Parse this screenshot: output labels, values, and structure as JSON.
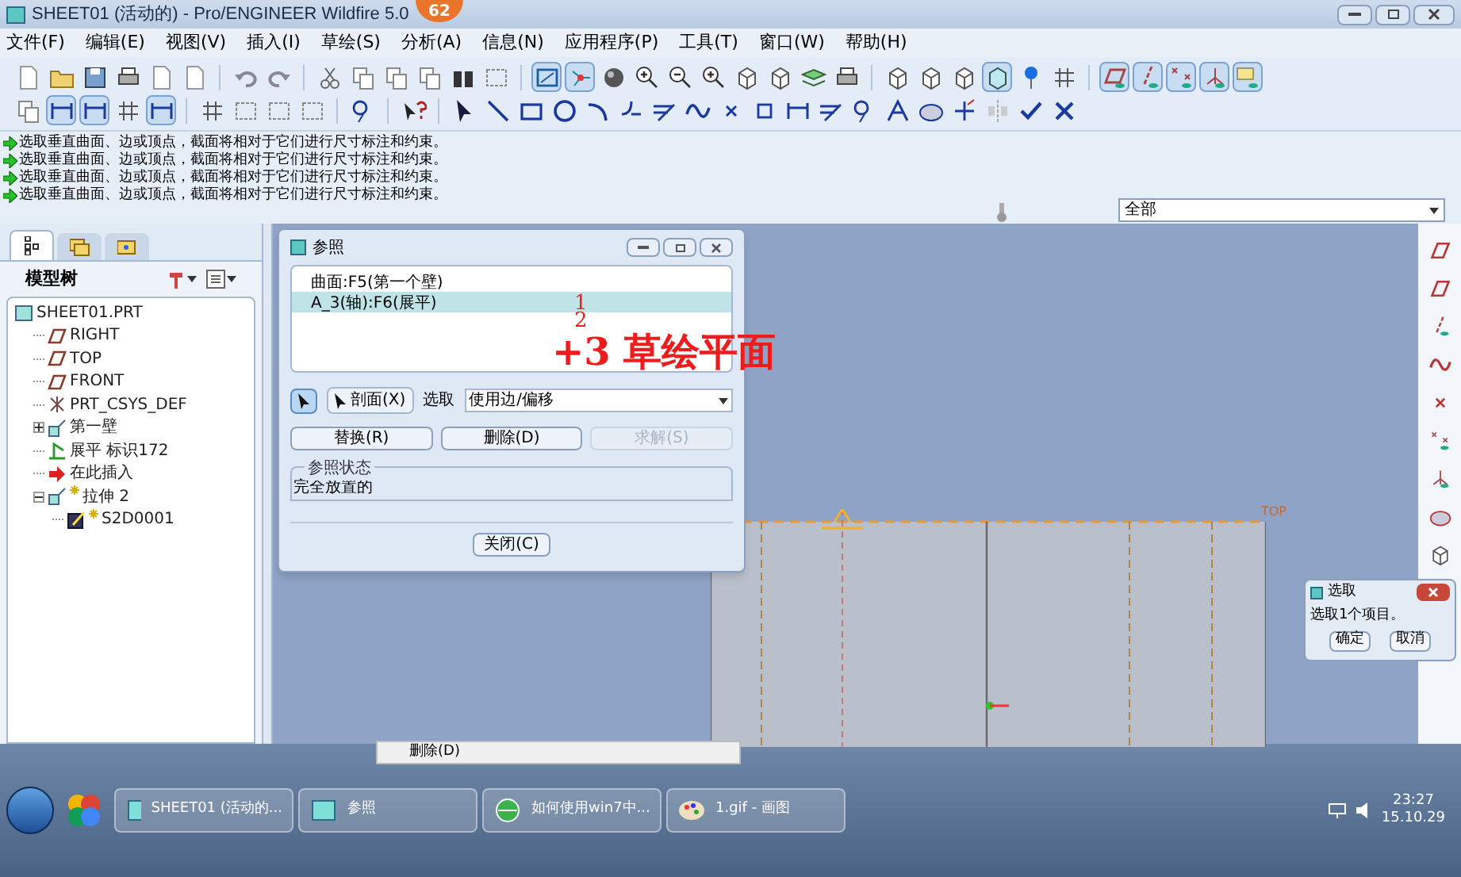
{
  "window": {
    "title": "SHEET01 (活动的) - Pro/ENGINEER Wildfire 5.0",
    "badge": "62"
  },
  "menu": [
    "文件(F)",
    "编辑(E)",
    "视图(V)",
    "插入(I)",
    "草绘(S)",
    "分析(A)",
    "信息(N)",
    "应用程序(P)",
    "工具(T)",
    "窗口(W)",
    "帮助(H)"
  ],
  "messages": [
    "选取垂直曲面、边或顶点，截面将相对于它们进行尺寸标注和约束。",
    "选取垂直曲面、边或顶点，截面将相对于它们进行尺寸标注和约束。",
    "选取垂直曲面、边或顶点，截面将相对于它们进行尺寸标注和约束。",
    "选取垂直曲面、边或顶点，截面将相对于它们进行尺寸标注和约束。"
  ],
  "filter": {
    "value": "全部"
  },
  "model_tree": {
    "title": "模型树",
    "items": [
      {
        "label": "SHEET01.PRT",
        "kind": "part",
        "children": [
          {
            "label": "RIGHT",
            "kind": "plane"
          },
          {
            "label": "TOP",
            "kind": "plane"
          },
          {
            "label": "FRONT",
            "kind": "plane"
          },
          {
            "label": "PRT_CSYS_DEF",
            "kind": "csys"
          },
          {
            "label": "第一壁",
            "kind": "wall",
            "expanded": false
          },
          {
            "label": "展平 标识172",
            "kind": "unbend"
          },
          {
            "label": "在此插入",
            "kind": "insert"
          },
          {
            "label": "拉伸 2",
            "kind": "wall",
            "new": true,
            "expanded": true,
            "children": [
              {
                "label": "S2D0001",
                "kind": "sketch",
                "new": true
              }
            ]
          }
        ]
      }
    ]
  },
  "references_dialog": {
    "title": "参照",
    "references": [
      {
        "label": "曲面:F5(第一个壁)",
        "selected": false
      },
      {
        "label": "A_3(轴):F6(展平)",
        "selected": true
      }
    ],
    "section_button": "剖面(X)",
    "select_label": "选取",
    "select_value": "使用边/偏移",
    "buttons": [
      {
        "label": "替换(R)",
        "disabled": false
      },
      {
        "label": "删除(D)",
        "disabled": false
      },
      {
        "label": "求解(S)",
        "disabled": true
      }
    ],
    "status_title": "参照状态",
    "status": "完全放置的",
    "close_button": "关闭(C)"
  },
  "annotation": [
    "1",
    "2",
    "+3 草绘平面"
  ],
  "sketch": {
    "label": "TOP"
  },
  "select_popup": {
    "title": "选取",
    "message": "选取1个项目。",
    "ok": "确定",
    "cancel": "取消"
  },
  "context_menu": [
    "删除(D)"
  ],
  "taskbar": {
    "items": [
      {
        "label": "SHEET01 (活动的...",
        "kind": "proe"
      },
      {
        "label": "参照",
        "kind": "proe"
      },
      {
        "label": "如何使用win7中...",
        "kind": "browser"
      },
      {
        "label": "1.gif - 画图",
        "kind": "paint"
      }
    ],
    "time": "23:27",
    "date": "15.10.29"
  }
}
